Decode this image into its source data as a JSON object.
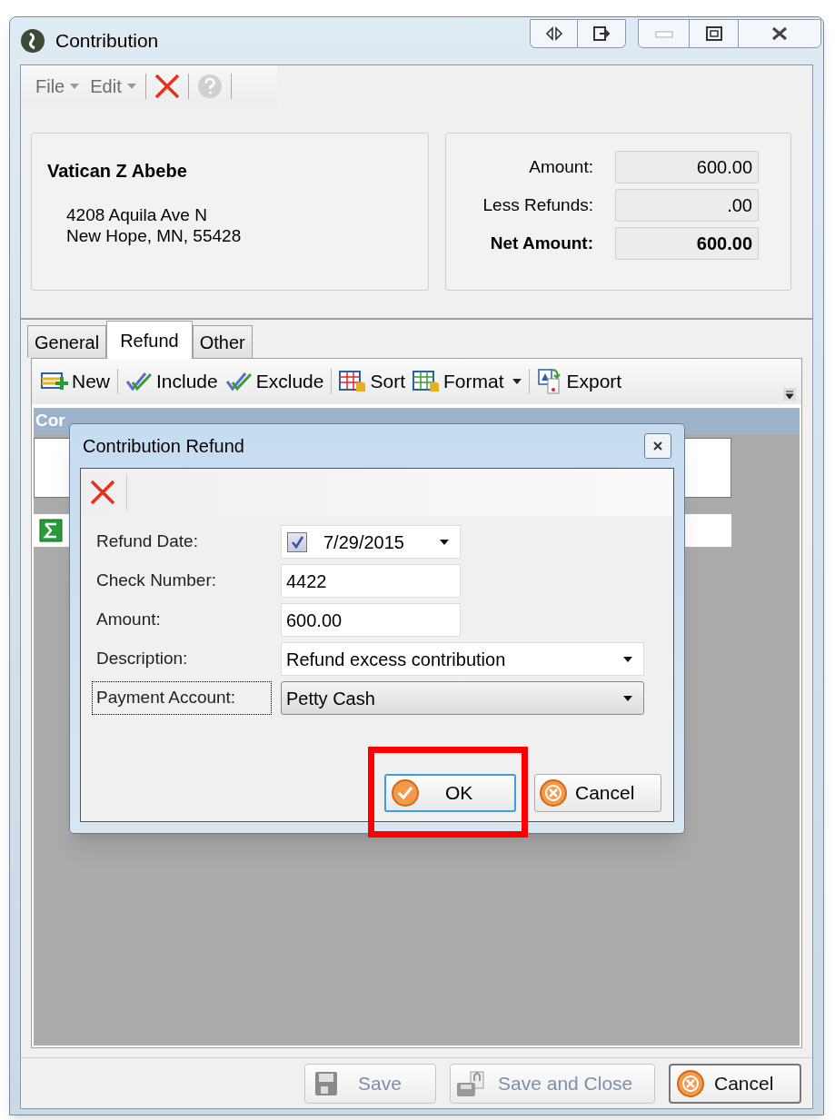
{
  "window": {
    "title": "Contribution"
  },
  "menu": [
    {
      "label": "File"
    },
    {
      "label": "Edit"
    }
  ],
  "menu_tools": [
    {
      "kind": "delete",
      "disabled": false
    },
    {
      "kind": "help",
      "disabled": true
    }
  ],
  "donor": {
    "name": "Vatican Z Abebe",
    "address_lines": [
      "4208 Aquila Ave N",
      "New Hope, MN, 55428"
    ]
  },
  "totals": [
    {
      "label": "Amount:",
      "value": "600.00",
      "bold": false
    },
    {
      "label": "Less Refunds:",
      "value": ".00",
      "bold": false
    },
    {
      "label": "Net Amount:",
      "value": "600.00",
      "bold": true
    }
  ],
  "tabs": [
    {
      "label": "General",
      "selected": false
    },
    {
      "label": "Refund",
      "selected": true
    },
    {
      "label": "Other",
      "selected": false
    }
  ],
  "toolbar": [
    {
      "kind": "new",
      "label": "New",
      "dropdown": false
    },
    {
      "kind": "include",
      "label": "Include",
      "dropdown": false
    },
    {
      "kind": "exclude",
      "label": "Exclude",
      "dropdown": false
    },
    {
      "kind": "sort",
      "label": "Sort",
      "dropdown": false
    },
    {
      "kind": "format",
      "label": "Format",
      "dropdown": true
    },
    {
      "kind": "export",
      "label": "Export",
      "dropdown": false
    }
  ],
  "grid": {
    "header": "Cor"
  },
  "dialog": {
    "title": "Contribution Refund",
    "fields": [
      {
        "kind": "date",
        "label": "Refund Date:",
        "value": "7/29/2015",
        "checked": true,
        "focused": false
      },
      {
        "kind": "text",
        "label": "Check Number:",
        "value": "4422",
        "focused": false
      },
      {
        "kind": "text",
        "label": "Amount:",
        "value": "600.00",
        "focused": false
      },
      {
        "kind": "combo",
        "label": "Description:",
        "value": "Refund excess contribution",
        "focused": false
      },
      {
        "kind": "dropdown",
        "label": "Payment Account:",
        "value": "Petty Cash",
        "focused": true
      }
    ],
    "buttons": [
      {
        "kind": "ok",
        "label": "OK",
        "highlighted": true
      },
      {
        "kind": "cancel",
        "label": "Cancel",
        "highlighted": false
      }
    ]
  },
  "footer_buttons": [
    {
      "kind": "save",
      "label": "Save",
      "disabled": true
    },
    {
      "kind": "save_close",
      "label": "Save and Close",
      "disabled": true
    },
    {
      "kind": "cancel",
      "label": "Cancel",
      "disabled": false
    }
  ]
}
